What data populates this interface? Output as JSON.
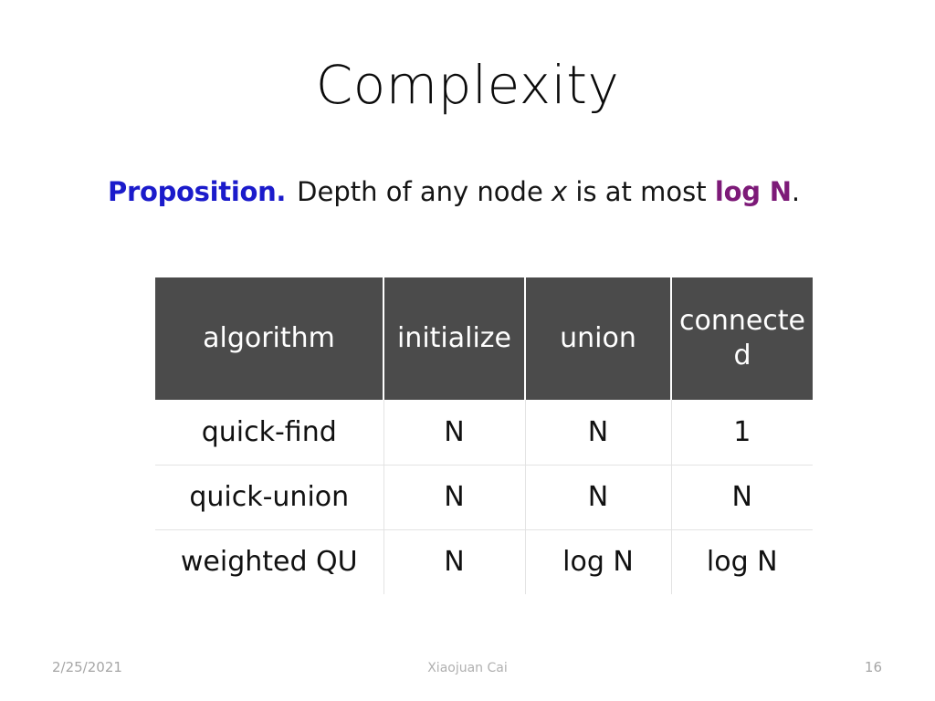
{
  "slide": {
    "title": "Complexity",
    "proposition": {
      "label": "Proposition.",
      "body_before_var": "Depth of any node ",
      "variable": "x",
      "body_after_var": " is at most ",
      "bound_prefix": "log ",
      "bound_variable": "N",
      "period": ".",
      "label_color": "#1b1bcb",
      "bound_color": "#7d1a78"
    },
    "table": {
      "headers": [
        "algorithm",
        "initialize",
        "union",
        "connected"
      ],
      "header_bg": "#4b4b4b",
      "header_text_color": "#ffffff",
      "accent_color": "#6e3130",
      "rows": [
        {
          "algorithm": "quick-find",
          "initialize": "N",
          "union": "N",
          "connected": "1",
          "accent": {
            "algorithm": false,
            "initialize": false,
            "union": false,
            "connected": false
          }
        },
        {
          "algorithm": "quick-union",
          "initialize": "N",
          "union": "N",
          "connected": "N",
          "accent": {
            "algorithm": false,
            "initialize": false,
            "union": false,
            "connected": false
          }
        },
        {
          "algorithm": "weighted QU",
          "initialize": "N",
          "union": "log N",
          "connected": "log N",
          "accent": {
            "algorithm": false,
            "initialize": false,
            "union": true,
            "connected": true
          }
        }
      ]
    },
    "footer": {
      "date": "2/25/2021",
      "author": "Xiaojuan Cai",
      "page_number": "16"
    }
  }
}
